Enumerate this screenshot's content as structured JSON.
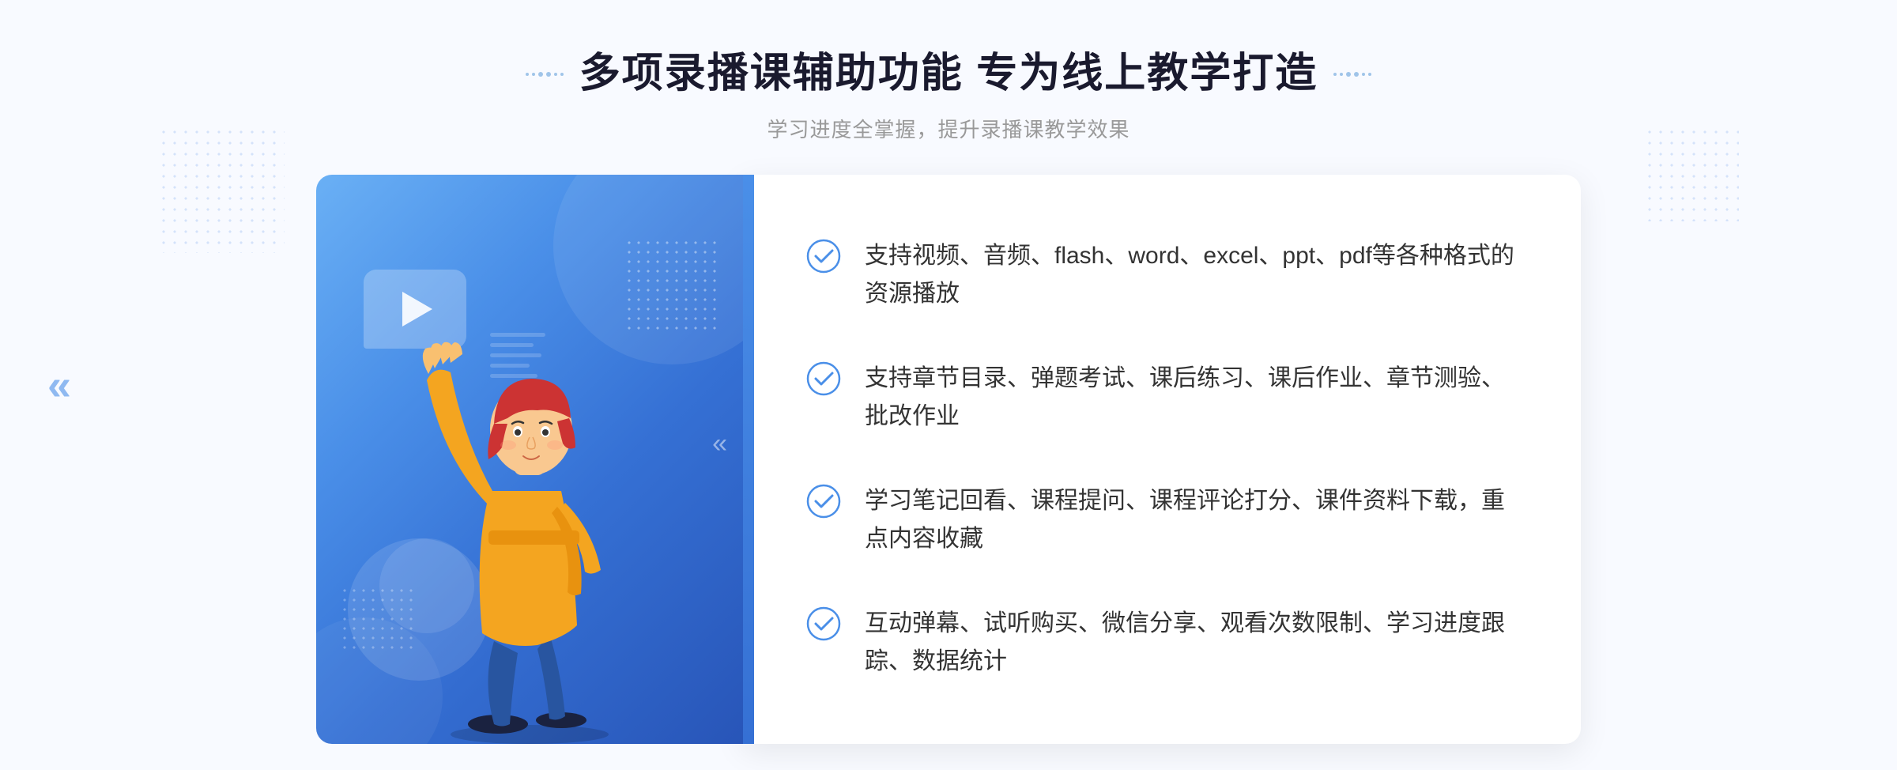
{
  "page": {
    "background_color": "#f4f8ff"
  },
  "header": {
    "title": "多项录播课辅助功能 专为线上教学打造",
    "subtitle": "学习进度全掌握，提升录播课教学效果"
  },
  "nav": {
    "chevron": "«"
  },
  "features": [
    {
      "id": 1,
      "text": "支持视频、音频、flash、word、excel、ppt、pdf等各种格式的资源播放"
    },
    {
      "id": 2,
      "text": "支持章节目录、弹题考试、课后练习、课后作业、章节测验、批改作业"
    },
    {
      "id": 3,
      "text": "学习笔记回看、课程提问、课程评论打分、课件资料下载，重点内容收藏"
    },
    {
      "id": 4,
      "text": "互动弹幕、试听购买、微信分享、观看次数限制、学习进度跟踪、数据统计"
    }
  ],
  "illustration": {
    "play_aria": "play button",
    "person_aria": "person pointing up illustration"
  },
  "decorations": {
    "chevron_label": "«"
  }
}
